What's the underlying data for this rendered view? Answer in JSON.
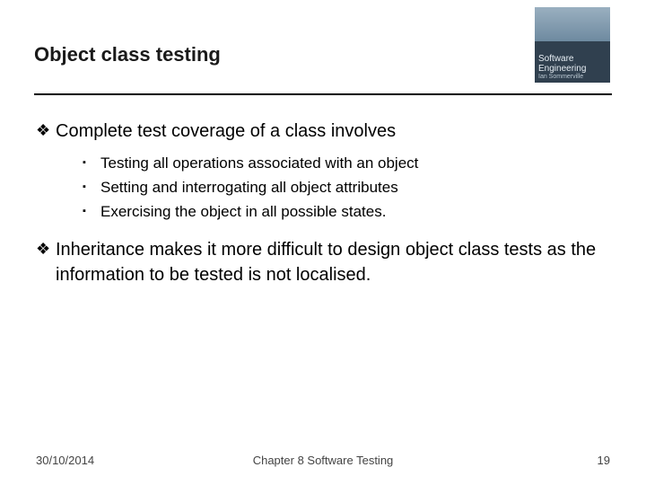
{
  "title": "Object class testing",
  "logo": {
    "label": "Software Engineering",
    "sub": "Ian Sommerville"
  },
  "points": [
    {
      "text": "Complete test coverage of a class involves",
      "sub": [
        "Testing all operations associated with an object",
        "Setting and interrogating all object attributes",
        "Exercising the object in all possible states."
      ]
    },
    {
      "text": "Inheritance makes it more difficult to design object class tests as the information to be tested is not localised.",
      "sub": []
    }
  ],
  "footer": {
    "date": "30/10/2014",
    "chapter": "Chapter 8 Software Testing",
    "page": "19"
  },
  "bullets": {
    "diamond": "❖",
    "square": "▪"
  }
}
